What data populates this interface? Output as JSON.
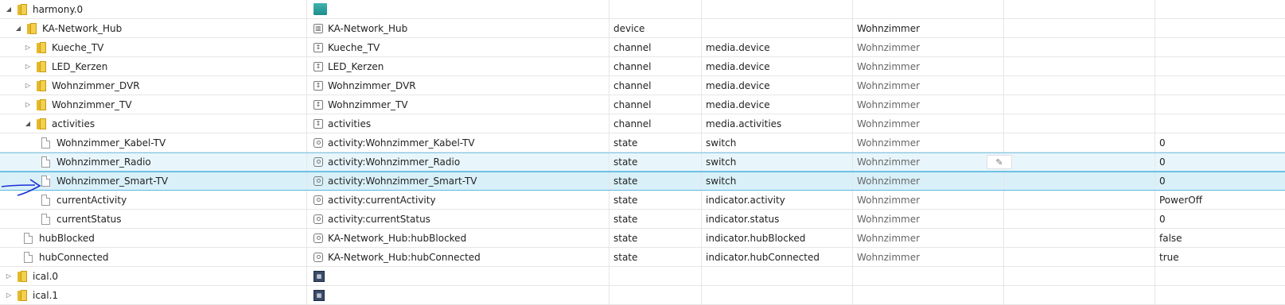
{
  "rows": [
    {
      "indent": 0,
      "toggle": "◢",
      "icon": "folder",
      "name": "harmony.0",
      "img": "teal",
      "alias": "",
      "type": "",
      "role": "",
      "room": "",
      "value": ""
    },
    {
      "indent": 1,
      "toggle": "◢",
      "icon": "folder",
      "name": "KA-Network_Hub",
      "img": "device",
      "alias": "KA-Network_Hub",
      "type": "device",
      "role": "",
      "room": "Wohnzimmer",
      "value": ""
    },
    {
      "indent": 2,
      "toggle": "▷",
      "icon": "folder",
      "name": "Kueche_TV",
      "img": "channel",
      "alias": "Kueche_TV",
      "type": "channel",
      "role": "media.device",
      "room": "Wohnzimmer",
      "value": ""
    },
    {
      "indent": 2,
      "toggle": "▷",
      "icon": "folder",
      "name": "LED_Kerzen",
      "img": "channel",
      "alias": "LED_Kerzen",
      "type": "channel",
      "role": "media.device",
      "room": "Wohnzimmer",
      "value": ""
    },
    {
      "indent": 2,
      "toggle": "▷",
      "icon": "folder",
      "name": "Wohnzimmer_DVR",
      "img": "channel",
      "alias": "Wohnzimmer_DVR",
      "type": "channel",
      "role": "media.device",
      "room": "Wohnzimmer",
      "value": ""
    },
    {
      "indent": 2,
      "toggle": "▷",
      "icon": "folder",
      "name": "Wohnzimmer_TV",
      "img": "channel",
      "alias": "Wohnzimmer_TV",
      "type": "channel",
      "role": "media.device",
      "room": "Wohnzimmer",
      "value": ""
    },
    {
      "indent": 2,
      "toggle": "◢",
      "icon": "folder",
      "name": "activities",
      "img": "channel",
      "alias": "activities",
      "type": "channel",
      "role": "media.activities",
      "room": "Wohnzimmer",
      "value": ""
    },
    {
      "indent": 3,
      "toggle": "",
      "icon": "file",
      "name": "Wohnzimmer_Kabel-TV",
      "img": "state",
      "alias": "activity:Wohnzimmer_Kabel-TV",
      "type": "state",
      "role": "switch",
      "room": "Wohnzimmer",
      "value": "0"
    },
    {
      "indent": 3,
      "toggle": "",
      "icon": "file",
      "name": "Wohnzimmer_Radio",
      "img": "state",
      "alias": "activity:Wohnzimmer_Radio",
      "type": "state",
      "role": "switch",
      "room": "Wohnzimmer",
      "value": "0"
    },
    {
      "indent": 3,
      "toggle": "",
      "icon": "file",
      "name": "Wohnzimmer_Smart-TV",
      "img": "state",
      "alias": "activity:Wohnzimmer_Smart-TV",
      "type": "state",
      "role": "switch",
      "room": "Wohnzimmer",
      "value": "0"
    },
    {
      "indent": 3,
      "toggle": "",
      "icon": "file",
      "name": "currentActivity",
      "img": "state",
      "alias": "activity:currentActivity",
      "type": "state",
      "role": "indicator.activity",
      "room": "Wohnzimmer",
      "value": "PowerOff"
    },
    {
      "indent": 3,
      "toggle": "",
      "icon": "file",
      "name": "currentStatus",
      "img": "state",
      "alias": "activity:currentStatus",
      "type": "state",
      "role": "indicator.status",
      "room": "Wohnzimmer",
      "value": "0"
    },
    {
      "indent": 2,
      "toggle": "",
      "icon": "file",
      "name": "hubBlocked",
      "img": "state",
      "alias": "KA-Network_Hub:hubBlocked",
      "type": "state",
      "role": "indicator.hubBlocked",
      "room": "Wohnzimmer",
      "value": "false"
    },
    {
      "indent": 2,
      "toggle": "",
      "icon": "file",
      "name": "hubConnected",
      "img": "state",
      "alias": "KA-Network_Hub:hubConnected",
      "type": "state",
      "role": "indicator.hubConnected",
      "room": "Wohnzimmer",
      "value": "true"
    },
    {
      "indent": 0,
      "toggle": "▷",
      "icon": "folder",
      "name": "ical.0",
      "img": "cal",
      "alias": "",
      "type": "",
      "role": "",
      "room": "",
      "value": ""
    },
    {
      "indent": 0,
      "toggle": "▷",
      "icon": "folder",
      "name": "ical.1",
      "img": "cal",
      "alias": "",
      "type": "",
      "role": "",
      "room": "",
      "value": ""
    }
  ],
  "edit_icon": "pencil-icon",
  "colors": {
    "selected_bg": "#e8f6fc",
    "selected_border": "#7fc8e8",
    "folder": "#f3d04e",
    "annotation": "#1a2fd6"
  }
}
